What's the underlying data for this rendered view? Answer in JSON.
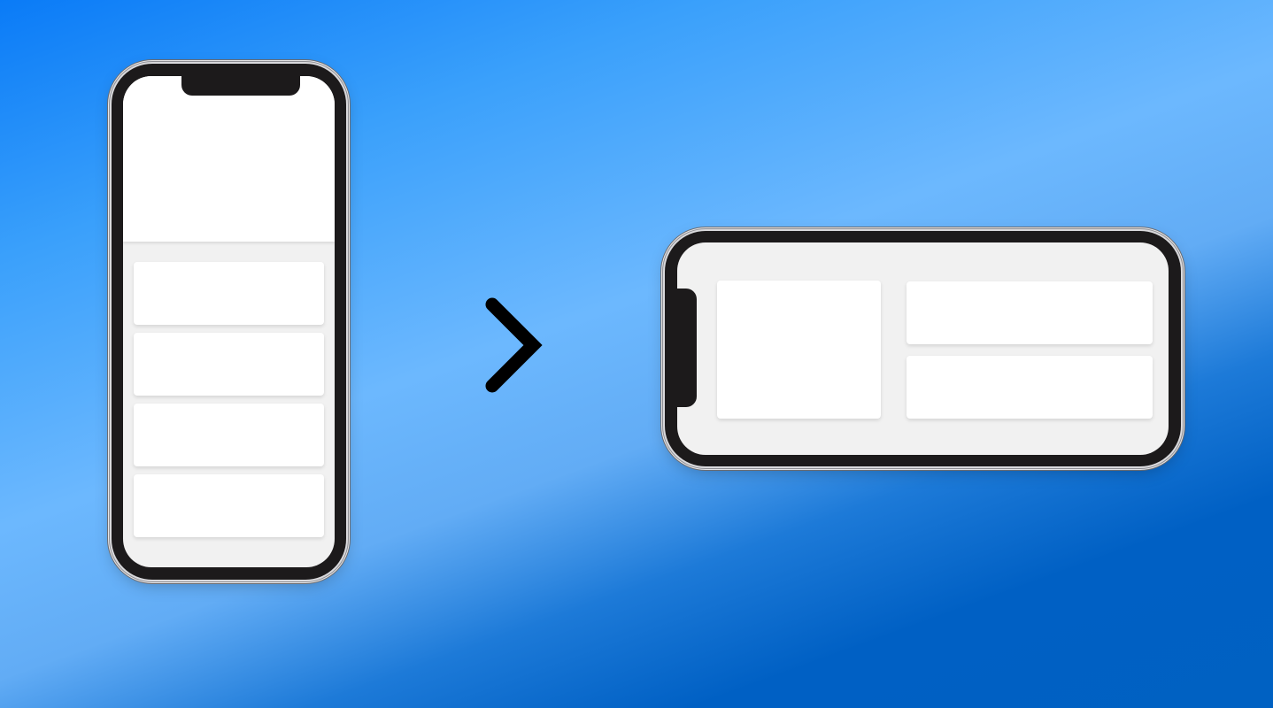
{
  "scene": {
    "background_colors": [
      "#0a7bf7",
      "#6cb8fe",
      "#0061c2"
    ],
    "frame_color": "#1c1a1b",
    "screen_background": "#f1f1f1",
    "card_color": "#ffffff"
  },
  "portrait_phone": {
    "orientation": "portrait",
    "header_panel": true,
    "card_count": 4
  },
  "transition": {
    "icon": "chevron-right-icon",
    "color": "#000000"
  },
  "landscape_phone": {
    "orientation": "landscape",
    "layout": "two-column",
    "left_cards": 1,
    "right_cards": 2
  }
}
